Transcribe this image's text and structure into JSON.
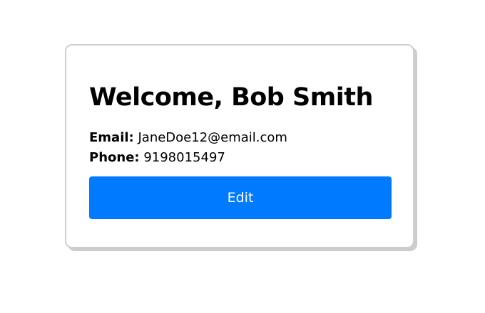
{
  "profile": {
    "welcome_text": "Welcome, Bob Smith",
    "email_label": "Email:",
    "email_value": "JaneDoe12@email.com",
    "phone_label": "Phone:",
    "phone_value": "9198015497",
    "edit_label": "Edit"
  },
  "colors": {
    "button_bg": "#007bff",
    "button_text": "#ffffff",
    "card_border": "#cfcfcf"
  }
}
